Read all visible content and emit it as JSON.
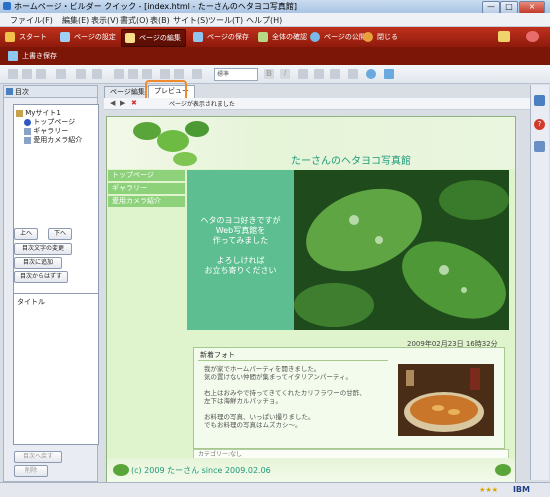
{
  "window": {
    "title": "ホームページ・ビルダー クイック - [index.html - たーさんのヘタヨコ写真館]",
    "controls": [
      "—",
      "□",
      "×"
    ]
  },
  "menu": [
    "ファイル(F)",
    "編集(E)",
    "表示(V)",
    "書式(O)",
    "表(B)",
    "サイト(S)",
    "ツール(T)",
    "ヘルプ(H)"
  ],
  "main_toolbar": {
    "start": "スタート",
    "page_settings": "ページの設定",
    "page_edit": "ページの編集",
    "page_save": "ページの保存",
    "check_all": "全体の確認",
    "publish": "ページの公開",
    "close": "閉じる"
  },
  "sub_toolbar": {
    "overwrite_save": "上書き保存"
  },
  "format_toolbar": {
    "style_value": "標準"
  },
  "left_panel": {
    "header": "目次",
    "tree": [
      {
        "label": "Myサイト1",
        "icon": "site-icon"
      },
      {
        "label": "トップページ",
        "icon": "home-page-icon"
      },
      {
        "label": "ギャラリー",
        "icon": "page-icon"
      },
      {
        "label": "愛用カメラ紹介",
        "icon": "page-icon"
      }
    ],
    "up_button": "上へ",
    "down_button": "下へ",
    "change_text_button": "目次文字の変更",
    "add_button": "目次に追加",
    "remove_button": "目次からはずす",
    "title_label": "タイトル",
    "back_button": "目次へ戻す",
    "delete_button": "削除"
  },
  "tabs": {
    "edit": "ページ編集",
    "preview": "プレビュー"
  },
  "preview_bar": {
    "message": "ページが表示されました"
  },
  "webpage": {
    "site_title": "たーさんのヘタヨコ写真館",
    "nav": [
      "トップページ",
      "ギャラリー",
      "愛用カメラ紹介"
    ],
    "hero_lines": [
      "ヘタのヨコ好きですが",
      "Web写真館を",
      "作ってみました",
      "",
      "よろしければ",
      "お立ち寄りください"
    ],
    "date": "2009年02月23日 16時32分",
    "news_heading": "新着フォト",
    "news_lines": [
      "我が家でホームパーティを開きました。",
      "気の置けない仲間が集まってイタリアンパーティ。",
      "",
      "右上はおみやで持ってきてくれたカリフラワーの甘酢、",
      "左下は海鮮カルパッチョ。",
      "",
      "お料理の写真、いっぱい撮りました。",
      "でもお料理の写真はムズカシ～。"
    ],
    "category": "カテゴリー:なし",
    "footer": "(c) 2009 たーさん since 2009.02.06"
  },
  "status": {
    "stars": "★★★",
    "brand": "IBM"
  },
  "colors": {
    "accent_red": "#a7230f",
    "tab_highlight": "#f08a2c",
    "site_green": "#1c9a78"
  }
}
